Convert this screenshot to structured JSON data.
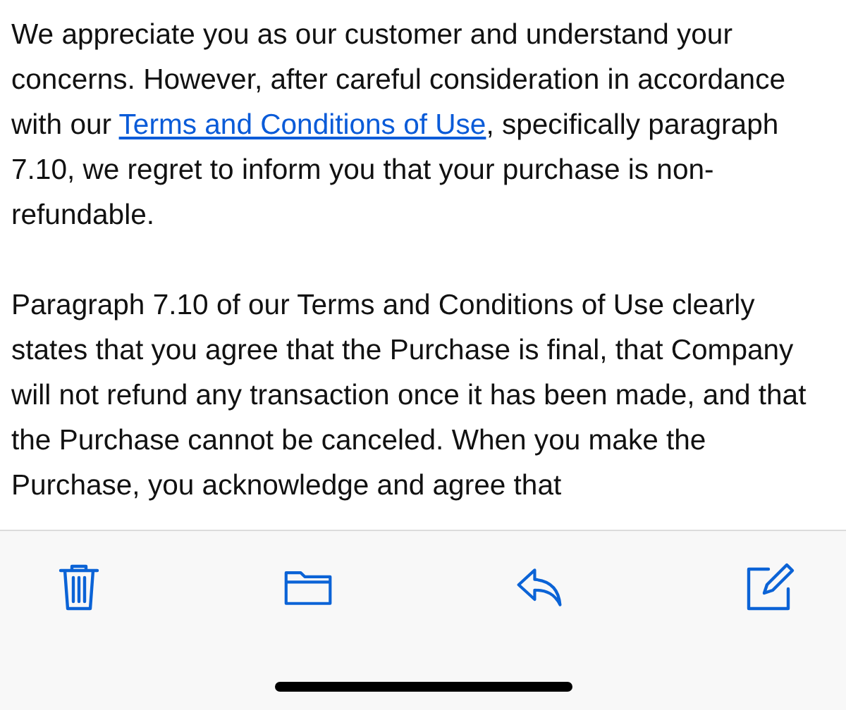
{
  "message": {
    "paragraphs": [
      {
        "before": "We appreciate you as our customer and understand your concerns. However, after careful consideration in accordance with our ",
        "link": "Terms and Conditions of Use",
        "after": ", specifically paragraph 7.10, we regret to inform you that your purchase is non-refundable."
      },
      {
        "before": "Paragraph 7.10 of our Terms and Conditions of Use clearly states that you agree that the Purchase is final, that Company will not refund any transaction once it has been made, and that the Purchase cannot be canceled. When you make the Purchase, you acknowledge and agree that"
      }
    ]
  }
}
